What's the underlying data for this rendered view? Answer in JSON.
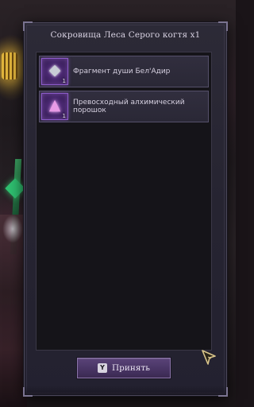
{
  "panel": {
    "title": "Сокровища Леса Серого когтя x1"
  },
  "items": [
    {
      "name": "Фрагмент души Бел'Адир",
      "count": "1",
      "icon": "soul-fragment-icon",
      "icon_glyph": "◆"
    },
    {
      "name": "Превосходный алхимический порошок",
      "count": "1",
      "icon": "alchemy-powder-icon",
      "icon_glyph": "▲"
    }
  ],
  "accept_button": {
    "key": "Y",
    "label": "Принять"
  },
  "colors": {
    "panel_bg": "#262431",
    "item_rarity_glow": "#8a5ac8",
    "button_bg": "#4a3666",
    "cursor": "#d8c48a"
  }
}
